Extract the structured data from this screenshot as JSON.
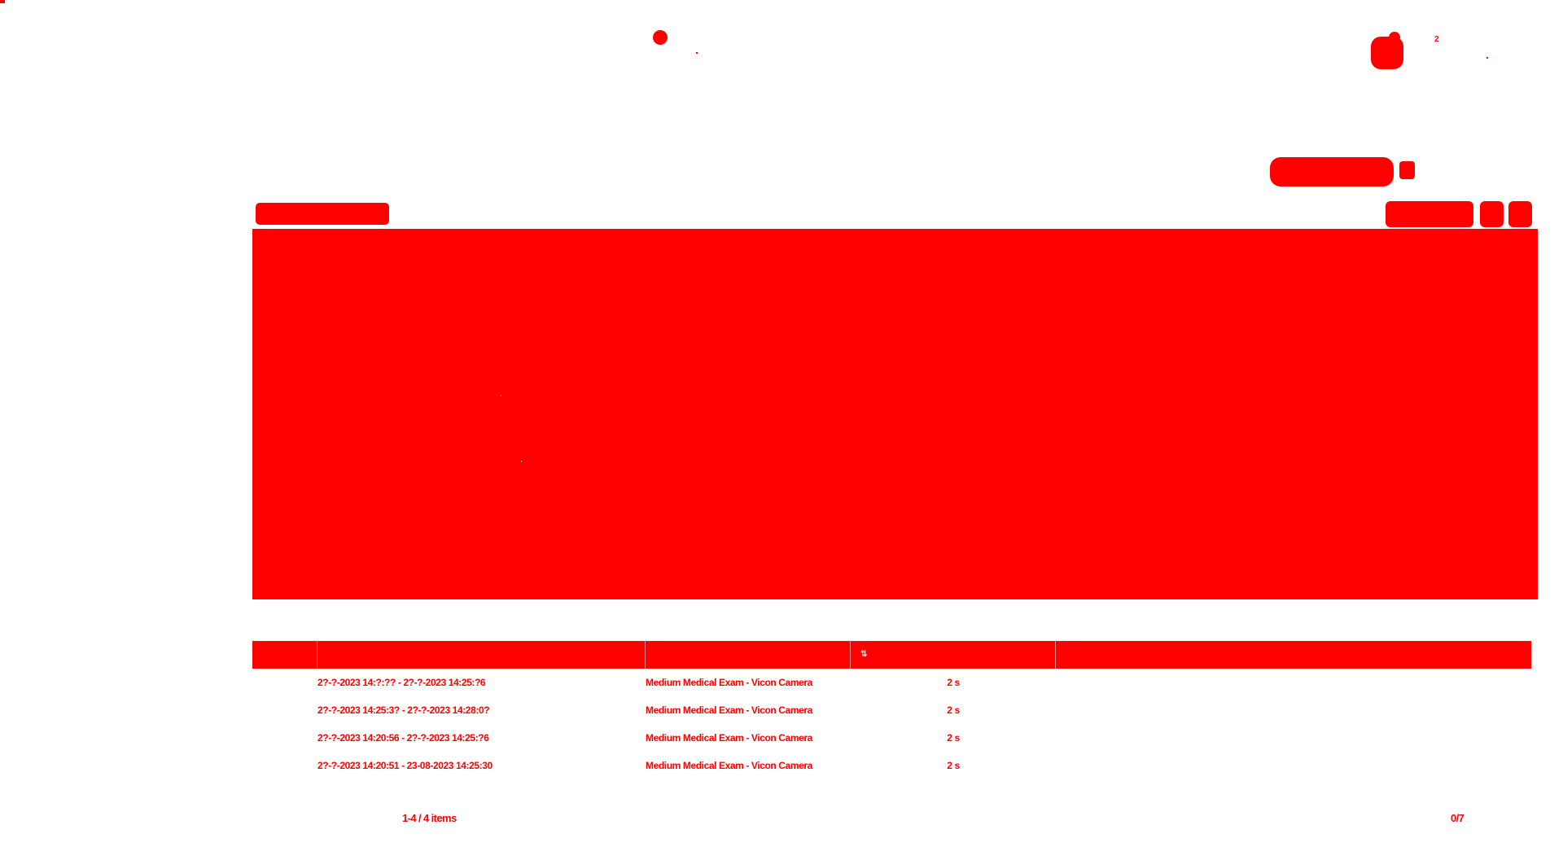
{
  "colors": {
    "fill": "#ff0000"
  },
  "header": {
    "notification_count": "2"
  },
  "table": {
    "columns": [
      {
        "label": ""
      },
      {
        "label": ""
      },
      {
        "label": ""
      },
      {
        "label": ""
      },
      {
        "label": ""
      }
    ],
    "rows": [
      {
        "time_range": "2?-?-2023 14:?:?? - 2?-?-2023 14:25:?6",
        "source": "Medium Medical Exam - Vicon Camera",
        "duration": "2 s"
      },
      {
        "time_range": "2?-?-2023 14:25:3? - 2?-?-2023 14:28:0?",
        "source": "Medium Medical Exam - Vicon Camera",
        "duration": "2 s"
      },
      {
        "time_range": "2?-?-2023 14:20:56 - 2?-?-2023 14:25:?6",
        "source": "Medium Medical Exam - Vicon Camera",
        "duration": "2 s"
      },
      {
        "time_range": "2?-?-2023 14:20:51 - 23-08-2023 14:25:30",
        "source": "Medium Medical Exam - Vicon Camera",
        "duration": "2 s"
      }
    ]
  },
  "footer": {
    "count": "1-4 / 4 items",
    "page": "0/7"
  }
}
